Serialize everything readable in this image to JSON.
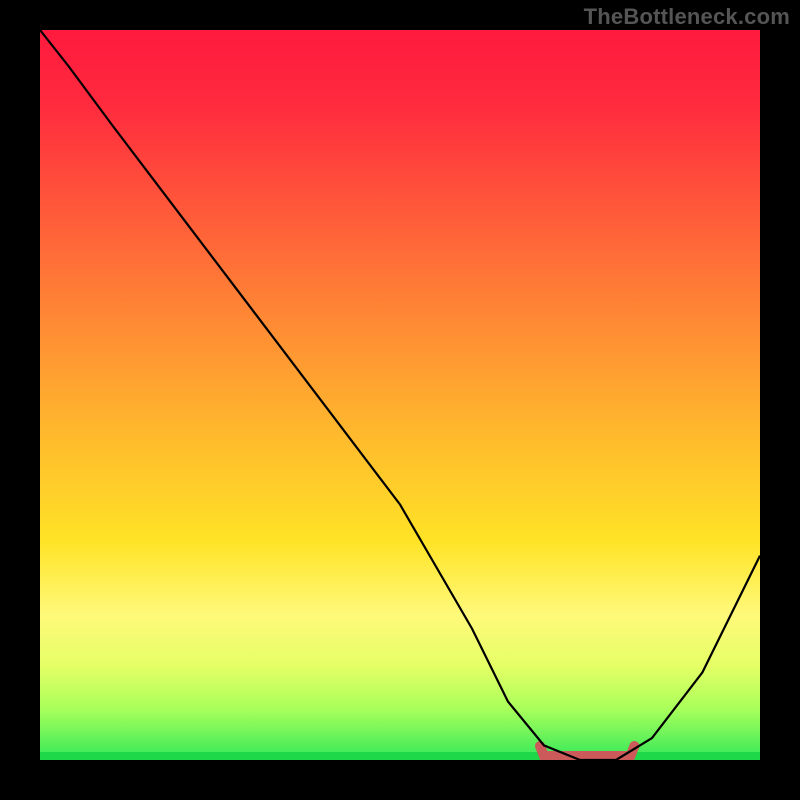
{
  "attribution": "TheBottleneck.com",
  "chart_data": {
    "type": "line",
    "title": "",
    "xlabel": "",
    "ylabel": "",
    "xlim": [
      0,
      100
    ],
    "ylim": [
      0,
      100
    ],
    "grid": false,
    "series": [
      {
        "name": "bottleneck-curve",
        "x": [
          0,
          4,
          10,
          20,
          30,
          40,
          50,
          60,
          65,
          70,
          75,
          80,
          85,
          92,
          100
        ],
        "values": [
          100,
          95,
          87,
          74,
          61,
          48,
          35,
          18,
          8,
          2,
          0,
          0,
          3,
          12,
          28
        ]
      }
    ],
    "annotations": [
      {
        "name": "optimal-flat-band",
        "x_start": 70,
        "x_end": 82,
        "y": 0,
        "color": "#cc5a5a"
      }
    ],
    "background_gradient": {
      "top": "#ff1a3e",
      "bottom": "#32e85a"
    }
  }
}
